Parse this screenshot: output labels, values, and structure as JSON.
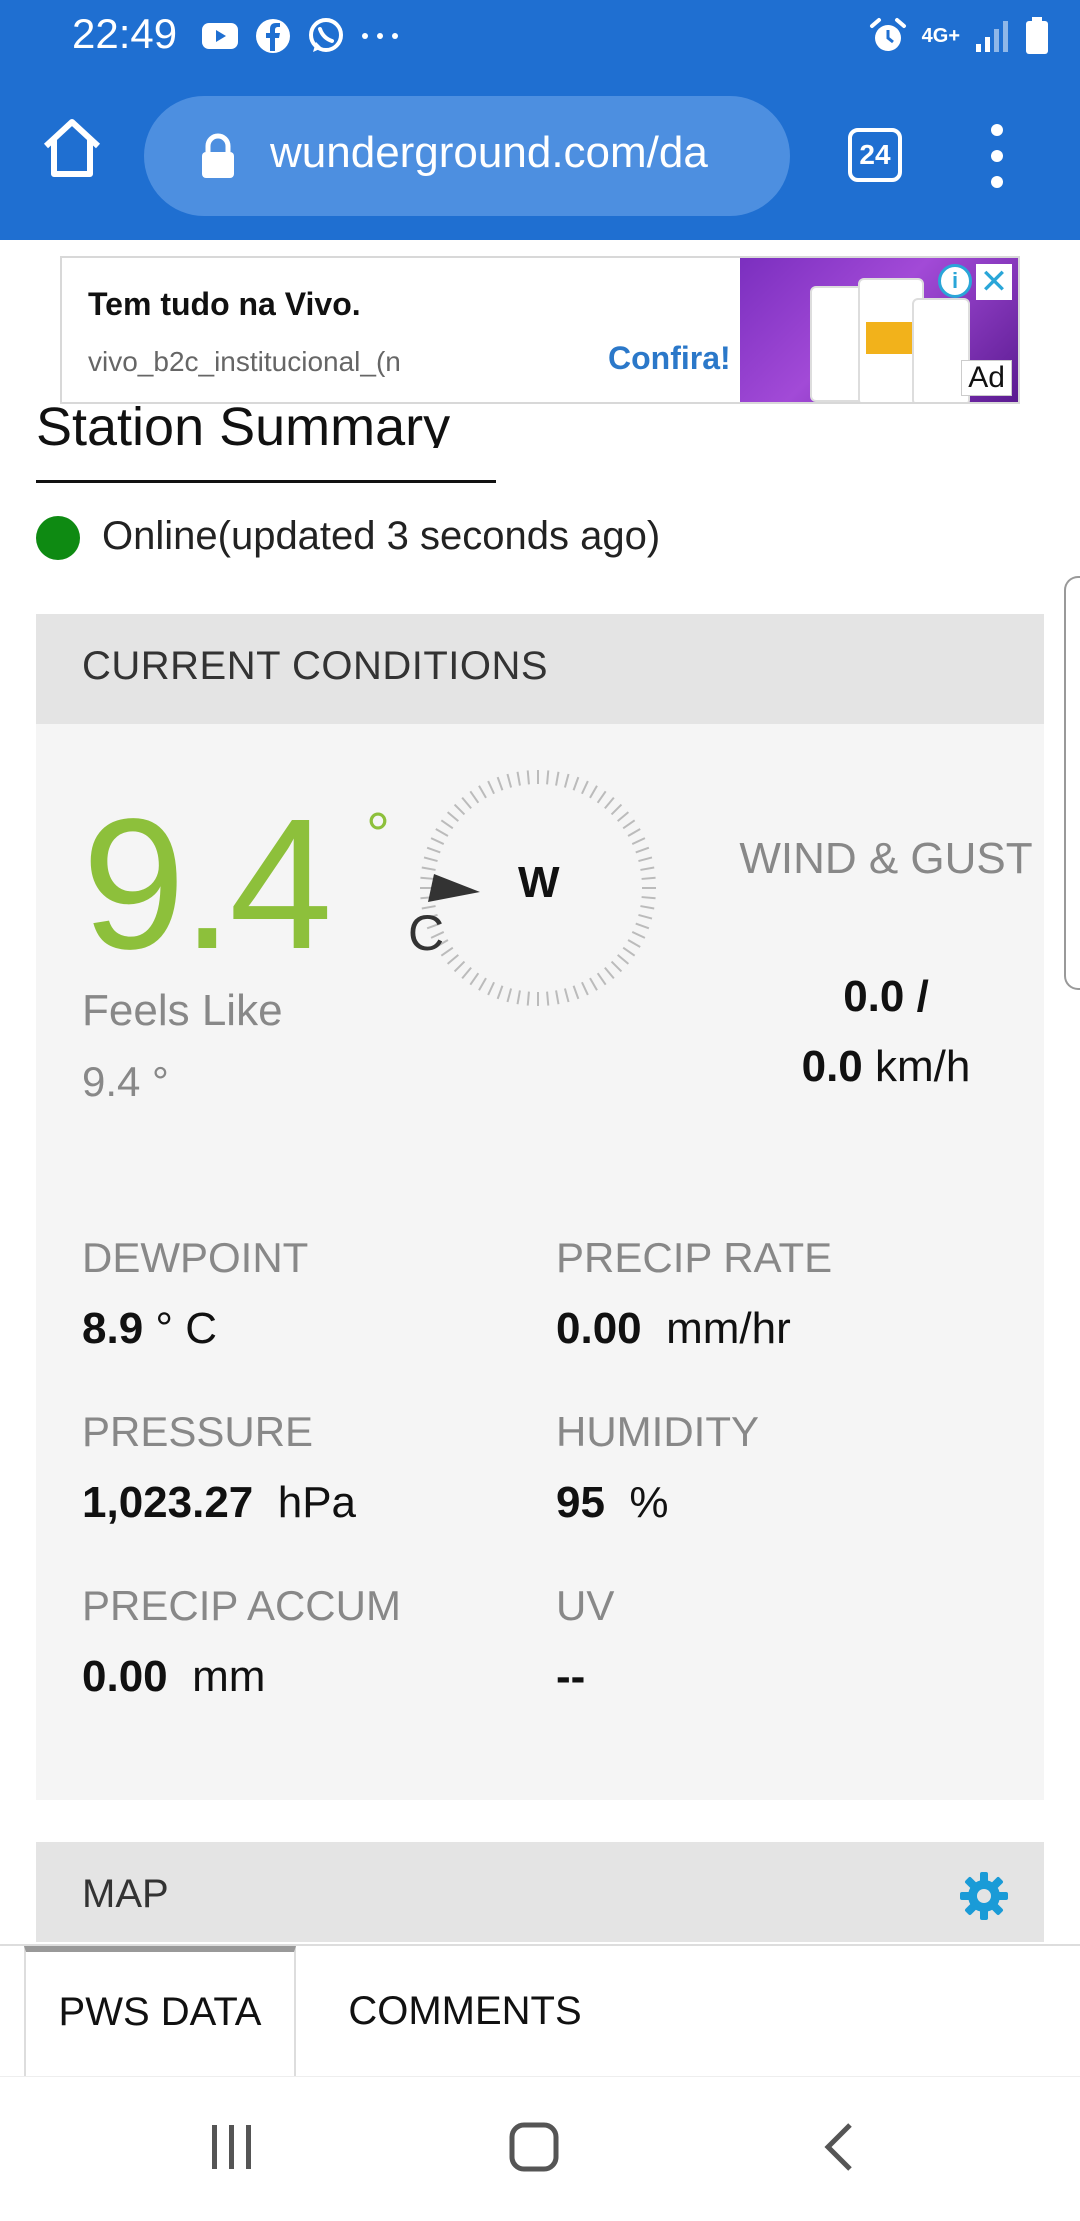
{
  "status": {
    "time": "22:49",
    "network": "4G+"
  },
  "browser": {
    "url": "wunderground.com/da",
    "tab_count": "24"
  },
  "ad": {
    "headline": "Tem tudo na Vivo.",
    "sub": "vivo_b2c_institucional_(n",
    "cta": "Confira!",
    "badge": "Ad",
    "info": "i",
    "close": "✕"
  },
  "station": {
    "title": "Station Summary",
    "status": "Online(updated 3 seconds ago)"
  },
  "current": {
    "header": "CURRENT CONDITIONS",
    "temp": "9.4",
    "deg": "°",
    "unit": "C",
    "wind_dir": "W",
    "feels_label": "Feels Like",
    "feels_value": "9.4 °",
    "wind_label": "WIND & GUST",
    "wind_speed": "0.0  /",
    "gust_speed": "0.0",
    "wind_unit": "km/h",
    "stats": {
      "dewpoint": {
        "label": "DEWPOINT",
        "value": "8.9",
        "unit": " ° C"
      },
      "precip_rate": {
        "label": "PRECIP RATE",
        "value": "0.00",
        "unit": "  mm/hr"
      },
      "pressure": {
        "label": "PRESSURE",
        "value": "1,023.27",
        "unit": "  hPa"
      },
      "humidity": {
        "label": "HUMIDITY",
        "value": "95",
        "unit": "  %"
      },
      "precip_accum": {
        "label": "PRECIP ACCUM",
        "value": "0.00",
        "unit": "  mm"
      },
      "uv": {
        "label": "UV",
        "value": "--",
        "unit": ""
      }
    }
  },
  "map": {
    "header": "MAP"
  },
  "tabs": {
    "pws": "PWS DATA",
    "comments": "COMMENTS"
  },
  "colors": {
    "toolbar": "#1f6fd1",
    "temp": "#8dc03b",
    "online": "#0e8a12",
    "gear": "#1a9bd7"
  }
}
